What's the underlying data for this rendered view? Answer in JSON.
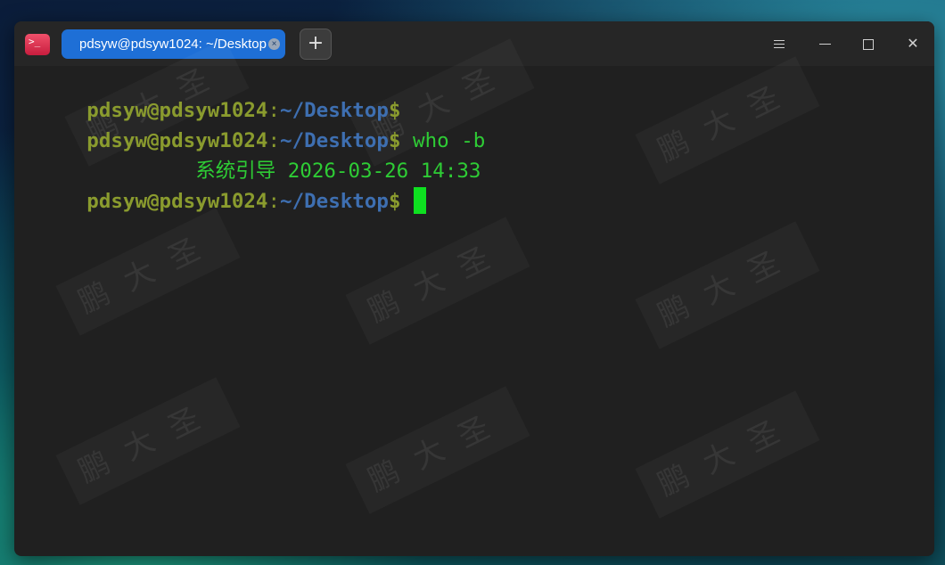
{
  "window": {
    "tab_title": "pdsyw@pdsyw1024: ~/Desktop",
    "tab_close_glyph": "×",
    "new_tab_glyph": "+",
    "close_glyph": "✕"
  },
  "terminal": {
    "lines": [
      {
        "user": "pdsyw@pdsyw1024",
        "sep": ":",
        "path": "~/Desktop",
        "prompt": "$",
        "command": ""
      },
      {
        "user": "pdsyw@pdsyw1024",
        "sep": ":",
        "path": "~/Desktop",
        "prompt": "$",
        "command": " who -b"
      },
      {
        "output": "         系统引导 2026-03-26 14:33"
      },
      {
        "user": "pdsyw@pdsyw1024",
        "sep": ":",
        "path": "~/Desktop",
        "prompt": "$",
        "command": ""
      }
    ]
  },
  "watermark": {
    "text": "鹏大圣"
  },
  "icons": {
    "app": "terminal-icon",
    "menu": "hamburger-menu-icon",
    "minimize": "minimize-icon",
    "maximize": "maximize-icon",
    "close": "close-icon"
  },
  "colors": {
    "user": "#8a9b2e",
    "path": "#3e6fb1",
    "command": "#2ecc35",
    "cursor": "#0ee020",
    "tab_active": "#1e6fd6",
    "background": "#202020"
  }
}
